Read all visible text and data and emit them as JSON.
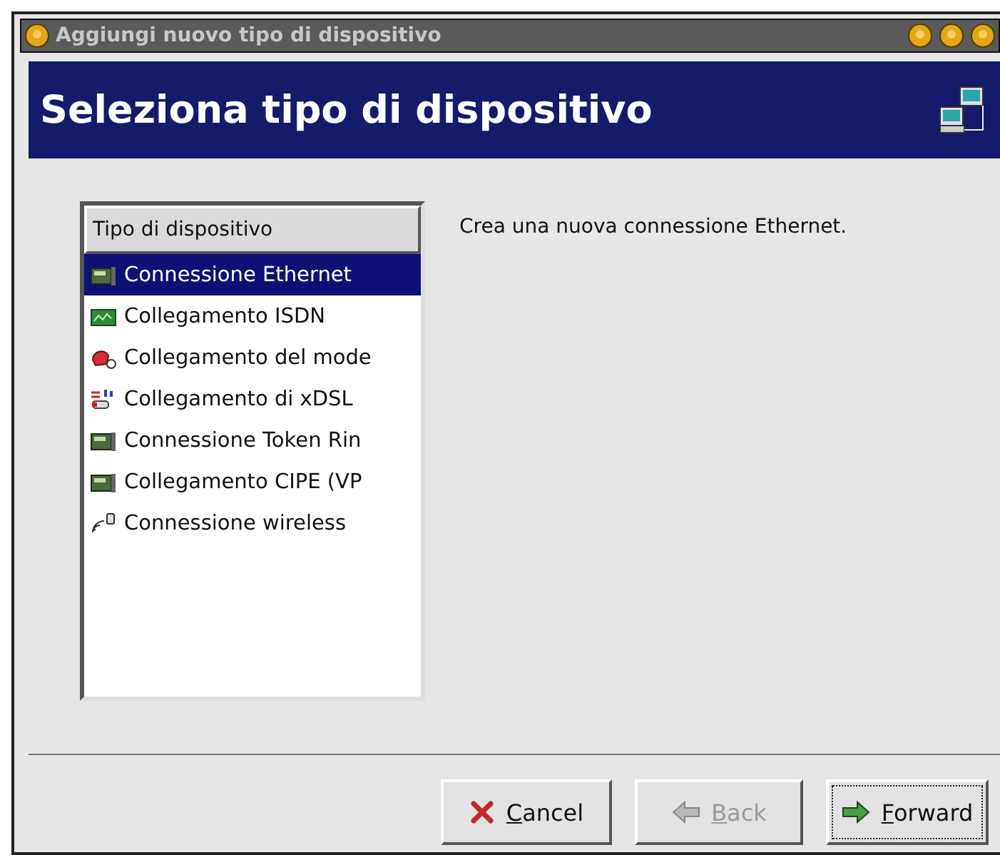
{
  "window": {
    "title": "Aggiungi nuovo tipo di dispositivo"
  },
  "header": {
    "title": "Seleziona tipo di dispositivo"
  },
  "device_list": {
    "column": "Tipo di dispositivo",
    "items": [
      {
        "label": "Connessione Ethernet",
        "kind": "card",
        "selected": true
      },
      {
        "label": "Collegamento ISDN",
        "kind": "isdn",
        "selected": false
      },
      {
        "label": "Collegamento del mode",
        "kind": "modem",
        "selected": false
      },
      {
        "label": "Collegamento di xDSL",
        "kind": "xdsl",
        "selected": false
      },
      {
        "label": "Connessione Token Rin",
        "kind": "card",
        "selected": false
      },
      {
        "label": "Collegamento CIPE (VP",
        "kind": "card",
        "selected": false
      },
      {
        "label": "Connessione wireless",
        "kind": "wireless",
        "selected": false
      }
    ]
  },
  "description": "Crea una nuova connessione Ethernet.",
  "buttons": [
    {
      "label": "Cancel",
      "kind": "cancel",
      "disabled": false,
      "focused": false,
      "mnemonic": true
    },
    {
      "label": "Back",
      "kind": "back",
      "disabled": true,
      "focused": false,
      "mnemonic": true
    },
    {
      "label": "Forward",
      "kind": "forward",
      "disabled": false,
      "focused": true,
      "mnemonic": true
    }
  ]
}
